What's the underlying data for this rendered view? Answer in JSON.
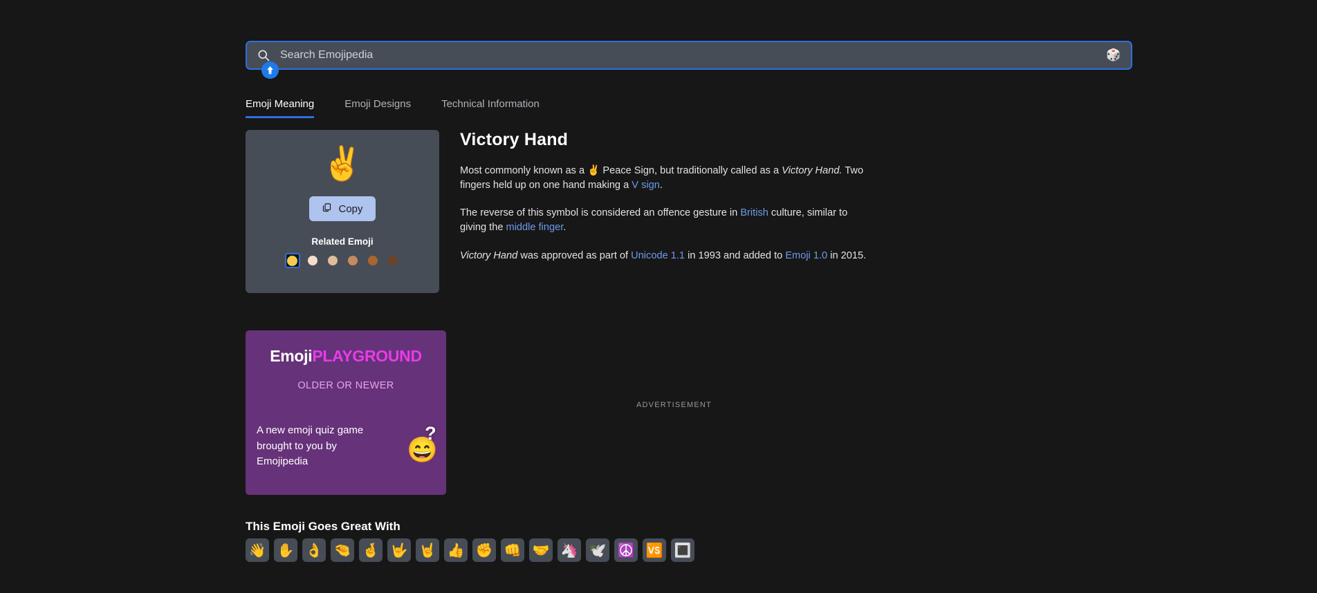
{
  "search": {
    "placeholder": "Search Emojipedia",
    "value": "",
    "search_icon": "search-icon",
    "dice_icon": "🎲",
    "badge_icon": "upload-arrow-icon"
  },
  "tabs": [
    {
      "label": "Emoji Meaning",
      "active": true
    },
    {
      "label": "Emoji Designs",
      "active": false
    },
    {
      "label": "Technical Information",
      "active": false
    }
  ],
  "emoji_card": {
    "glyph": "✌️",
    "copy_label": "Copy",
    "copy_icon": "copy-icon",
    "related_label": "Related Emoji",
    "swatches": [
      {
        "name": "default-yellow",
        "color": "#f5cb4e",
        "selected": true
      },
      {
        "name": "light-skin-tone",
        "color": "#f4ddcd",
        "selected": false
      },
      {
        "name": "medium-light-skin-tone",
        "color": "#e0bc9b",
        "selected": false
      },
      {
        "name": "medium-skin-tone",
        "color": "#c58a5f",
        "selected": false
      },
      {
        "name": "medium-dark-skin-tone",
        "color": "#a8662f",
        "selected": false
      },
      {
        "name": "dark-skin-tone",
        "color": "#6b4327",
        "selected": false
      }
    ]
  },
  "article": {
    "title": "Victory Hand",
    "p1_a": "Most commonly known as a ",
    "p1_emoji": "✌️",
    "p1_b": " Peace Sign, but traditionally called as a ",
    "p1_em1": "Victory Hand.",
    "p1_c": " Two fingers held up on one hand making a ",
    "p1_link": "V sign",
    "p1_d": ".",
    "p2_a": "The reverse of this symbol is considered an offence gesture in ",
    "p2_link1": "British",
    "p2_b": " culture, similar to giving the ",
    "p2_link2": "middle finger",
    "p2_c": ".",
    "p3_em": "Victory Hand",
    "p3_a": " was approved as part of ",
    "p3_link1": "Unicode 1.1",
    "p3_b": " in 1993 and added to ",
    "p3_link2": "Emoji 1.0",
    "p3_c": " in 2015."
  },
  "banner": {
    "logo_white": "Emoji",
    "logo_magenta": "PLAYGROUND",
    "subtitle": "OLDER OR NEWER",
    "body": "A new emoji quiz game brought to you by Emojipedia",
    "art_emoji": "😄",
    "art_question": "?"
  },
  "advertisement": {
    "label": "ADVERTISEMENT"
  },
  "goes_great_with": {
    "title": "This Emoji Goes Great With",
    "emojis": [
      {
        "name": "waving-hand",
        "glyph": "👋"
      },
      {
        "name": "raised-hand",
        "glyph": "✋"
      },
      {
        "name": "ok-hand",
        "glyph": "👌"
      },
      {
        "name": "pinching-hand",
        "glyph": "🤏"
      },
      {
        "name": "crossed-fingers",
        "glyph": "🤞"
      },
      {
        "name": "love-you-gesture",
        "glyph": "🤟"
      },
      {
        "name": "sign-of-the-horns",
        "glyph": "🤘"
      },
      {
        "name": "thumbs-up",
        "glyph": "👍"
      },
      {
        "name": "raised-fist",
        "glyph": "✊"
      },
      {
        "name": "oncoming-fist",
        "glyph": "👊"
      },
      {
        "name": "handshake",
        "glyph": "🤝"
      },
      {
        "name": "unicorn",
        "glyph": "🦄"
      },
      {
        "name": "dove",
        "glyph": "🕊️"
      },
      {
        "name": "peace-symbol",
        "glyph": "☮️"
      },
      {
        "name": "vs-button",
        "glyph": "🆚"
      },
      {
        "name": "white-square-button",
        "glyph": "🔳"
      }
    ]
  }
}
